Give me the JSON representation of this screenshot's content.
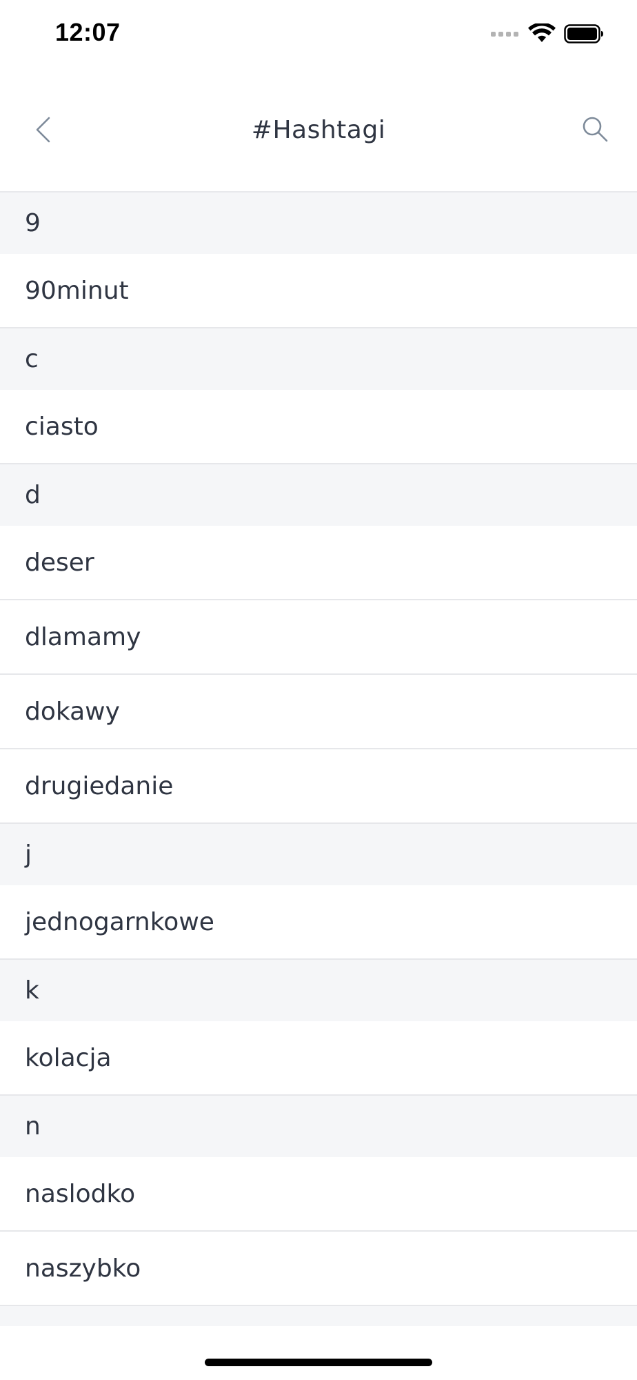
{
  "status_bar": {
    "time": "12:07"
  },
  "nav": {
    "title": "#Hashtagi",
    "back_icon": "chevron-left-icon",
    "search_icon": "search-icon"
  },
  "list": [
    {
      "type": "section",
      "label": "9"
    },
    {
      "type": "item",
      "label": "90minut"
    },
    {
      "type": "section",
      "label": "c"
    },
    {
      "type": "item",
      "label": "ciasto"
    },
    {
      "type": "section",
      "label": "d"
    },
    {
      "type": "item",
      "label": "deser"
    },
    {
      "type": "item",
      "label": "dlamamy"
    },
    {
      "type": "item",
      "label": "dokawy"
    },
    {
      "type": "item",
      "label": "drugiedanie"
    },
    {
      "type": "section",
      "label": "j"
    },
    {
      "type": "item",
      "label": "jednogarnkowe"
    },
    {
      "type": "section",
      "label": "k"
    },
    {
      "type": "item",
      "label": "kolacja"
    },
    {
      "type": "section",
      "label": "n"
    },
    {
      "type": "item",
      "label": "naslodko"
    },
    {
      "type": "item",
      "label": "naszybko"
    }
  ],
  "colors": {
    "text": "#2f3542",
    "section_bg": "#f5f6f8",
    "divider": "#e6e7ea",
    "icon": "#7d8a99"
  }
}
